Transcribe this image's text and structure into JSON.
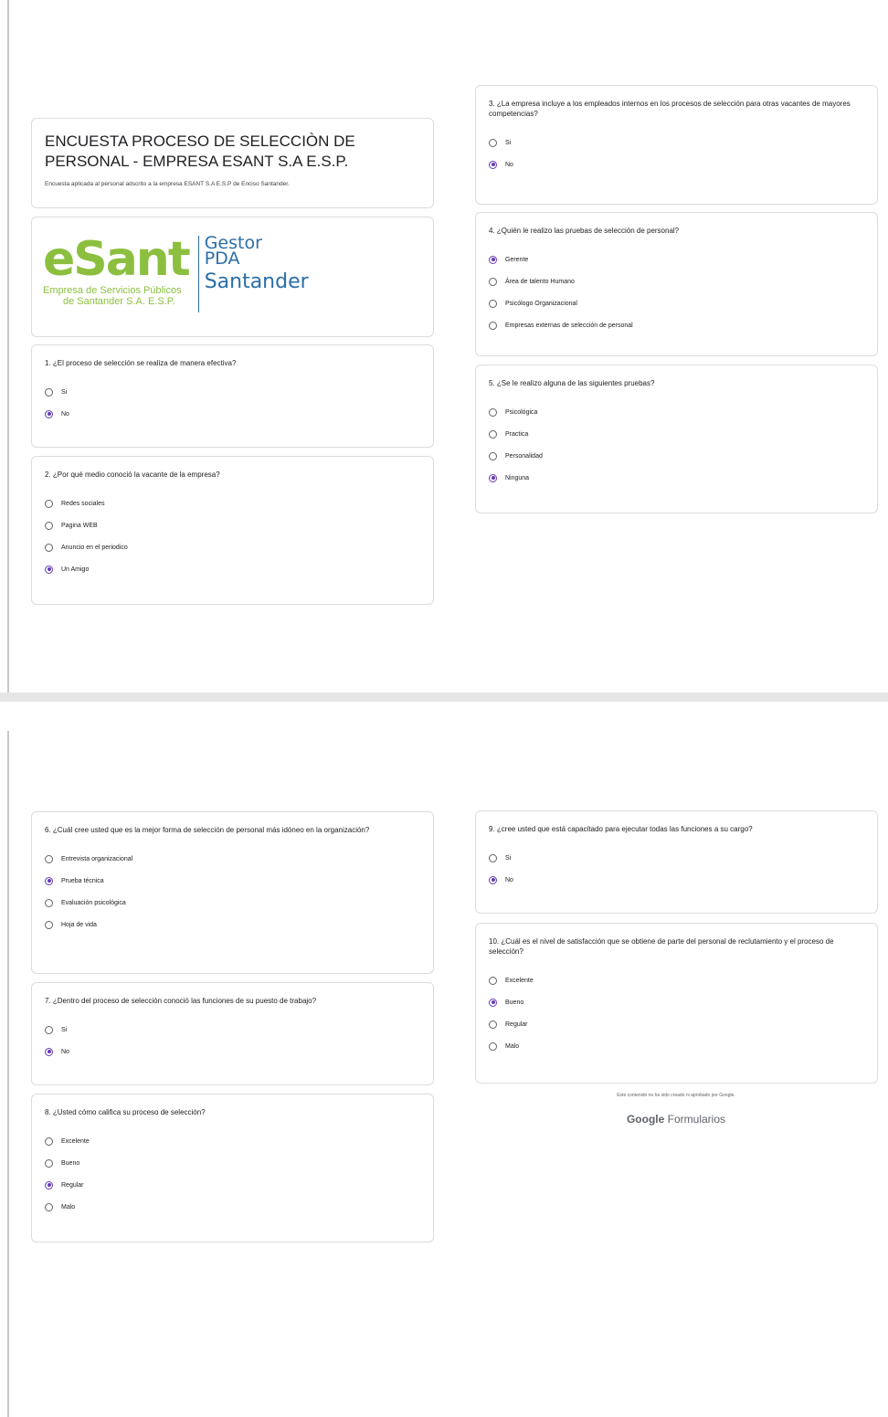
{
  "header": {
    "title": "ENCUESTA PROCESO DE SELECCIÒN DE PERSONAL - EMPRESA ESANT S.A E.S.P.",
    "description": "Encuesta aplicada al personal adscrito a la empresa ESANT S.A E.S.P de Enciso Santander."
  },
  "logo": {
    "wordmark": "eSant",
    "sub_line1": "Empresa de Servicios Públicos",
    "sub_line2": "de Santander S.A. E.S.P.",
    "right_line1": "Gestor",
    "right_line2": "PDA",
    "right_line3": "Santander"
  },
  "questions": [
    {
      "title": "1. ¿El proceso de selección se realiza de manera efectiva?",
      "options": [
        "Si",
        "No"
      ],
      "selected": 1
    },
    {
      "title": "2. ¿Por qué medio conoció la vacante de la empresa?",
      "options": [
        "Redes sociales",
        "Pagina WEB",
        "Anuncio en el periodico",
        "Un Amigo"
      ],
      "selected": 3
    },
    {
      "title": "3. ¿La empresa incluye a los empleados internos en los procesos de selección para otras vacantes de mayores competencias?",
      "options": [
        "Si",
        "No"
      ],
      "selected": 1
    },
    {
      "title": "4. ¿Quién le realizo las pruebas de selección de personal?",
      "options": [
        "Gerente",
        "Área de talento Humano",
        "Psicólogo Organizacional",
        "Empresas externas de selección de personal"
      ],
      "selected": 0
    },
    {
      "title": "5. ¿Se le realizo alguna de las siguientes pruebas?",
      "options": [
        "Psicológica",
        "Practica",
        "Personalidad",
        "Ninguna"
      ],
      "selected": 3
    },
    {
      "title": "6. ¿Cuál cree usted que es la mejor forma de selección de personal más idóneo en la organización?",
      "options": [
        "Entrevista organizacional",
        "Prueba técnica",
        "Evaluación psicológica",
        "Hoja de vida"
      ],
      "selected": 1
    },
    {
      "title": "7. ¿Dentro del proceso de selección conoció las funciones de su puesto de trabajo?",
      "options": [
        "Si",
        "No"
      ],
      "selected": 1
    },
    {
      "title": "8. ¿Usted cómo califica su proceso de selección?",
      "options": [
        "Excelente",
        "Bueno",
        "Regular",
        "Malo"
      ],
      "selected": 2
    },
    {
      "title": "9. ¿cree usted que está capacitado para ejecutar todas las funciones a su cargo?",
      "options": [
        "Si",
        "No"
      ],
      "selected": 1
    },
    {
      "title": "10. ¿Cuál es el nivel de satisfacción que se obtiene de parte del personal de reclutamiento y el proceso de selección?",
      "options": [
        "Excelente",
        "Bueno",
        "Regular",
        "Malo"
      ],
      "selected": 1
    }
  ],
  "footer": {
    "note": "Este contenido no ha sido creado ni aprobado por Google.",
    "brand_google": "Google",
    "brand_forms": "Formularios"
  },
  "colors": {
    "accent": "#673ab7",
    "logo_green": "#8cbf3f",
    "logo_blue": "#2b6ea8"
  }
}
